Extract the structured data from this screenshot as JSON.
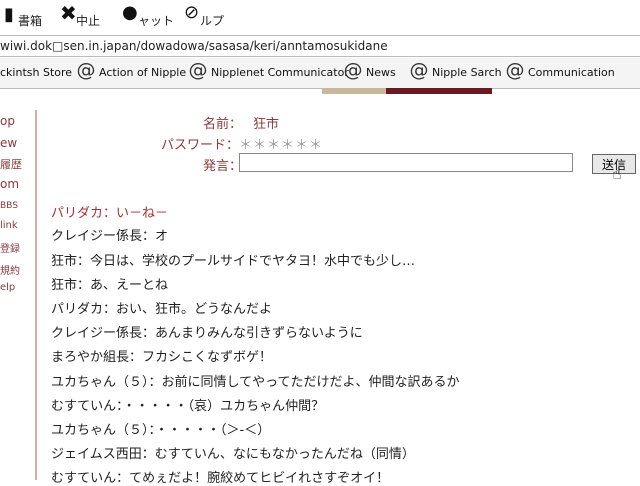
{
  "toolbar": {
    "bookmarks_label": "書箱",
    "stop_label": "中止",
    "chat_label": "ャット",
    "help_label": "ルプ"
  },
  "address": {
    "url": "wiwi.dok□sen.in.japan/dowadowa/sasasa/keri/anntamosukidane"
  },
  "links": [
    {
      "label": "ckintsh Store"
    },
    {
      "label": "Action of Nipple"
    },
    {
      "label": "Nipplenet Communicator"
    },
    {
      "label": "News"
    },
    {
      "label": "Nipple Sarch"
    },
    {
      "label": "Communication"
    }
  ],
  "leftnav": [
    "op",
    "ew",
    "履歴",
    "om",
    "BBS",
    "link",
    "登録",
    "規約",
    "elp"
  ],
  "form": {
    "name_label": "名前：",
    "name_value": "狂市",
    "password_label": "パスワード：",
    "password_value": "＊＊＊＊＊＊",
    "message_label": "発言：",
    "message_value": "",
    "send_label": "送信"
  },
  "chat": [
    {
      "text": "パリダカ：い－ね－",
      "color": "#a33333"
    },
    {
      "text": "クレイジー係長：オ",
      "color": "#222222"
    },
    {
      "text": "狂市：今日は、学校のプールサイドでヤタヨ！水中でも少し…",
      "color": "#222222"
    },
    {
      "text": "狂市：あ、えーとね",
      "color": "#222222"
    },
    {
      "text": "パリダカ：おい、狂市。どうなんだよ",
      "color": "#222222"
    },
    {
      "text": "クレイジー係長：あんまりみんな引きずらないように",
      "color": "#222222"
    },
    {
      "text": "まろやか組長：フカシこくなずボゲ！",
      "color": "#222222"
    },
    {
      "text": "ユカちゃん（５）：お前に同情してやってただけだよ、仲間な訳あるか",
      "color": "#222222"
    },
    {
      "text": "むすていん：・・・・・（哀）ユカちゃん仲間？",
      "color": "#222222"
    },
    {
      "text": "ユカちゃん（５）：・・・・・（＞-＜）",
      "color": "#222222"
    },
    {
      "text": "ジェイムス西田：むすていん、なにもなかったんだね（同情）",
      "color": "#222222"
    },
    {
      "text": "むすていん：てめぇだよ！腕絞めてヒビイれさすぞオイ！",
      "color": "#222222"
    }
  ]
}
